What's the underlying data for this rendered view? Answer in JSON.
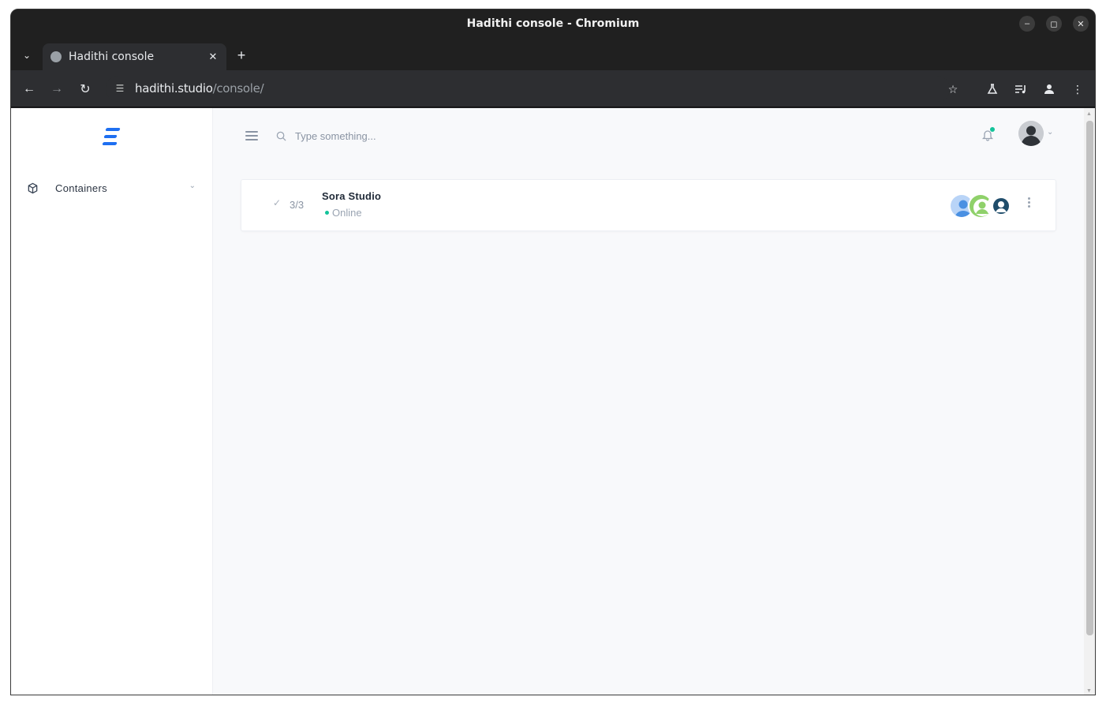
{
  "window": {
    "title": "Hadithi console - Chromium",
    "minimize_icon": "minimize-icon",
    "maximize_icon": "maximize-icon",
    "close_icon": "close-icon"
  },
  "tabs": [
    {
      "title": "Hadithi console",
      "active": true
    }
  ],
  "toolbar": {
    "url_host": "hadithi.studio",
    "url_path": "/console/"
  },
  "sidebar": {
    "logo": "hadithi-logo",
    "items": [
      {
        "label": "Containers",
        "icon": "cube-icon",
        "expanded": false
      }
    ]
  },
  "header": {
    "search_placeholder": "Type something...",
    "notification_unread": true
  },
  "containers": [
    {
      "name": "Sora Studio",
      "status": "Online",
      "count": "3/3",
      "members": 3
    }
  ],
  "colors": {
    "accent": "#1e6ff1",
    "online": "#13c39a"
  }
}
